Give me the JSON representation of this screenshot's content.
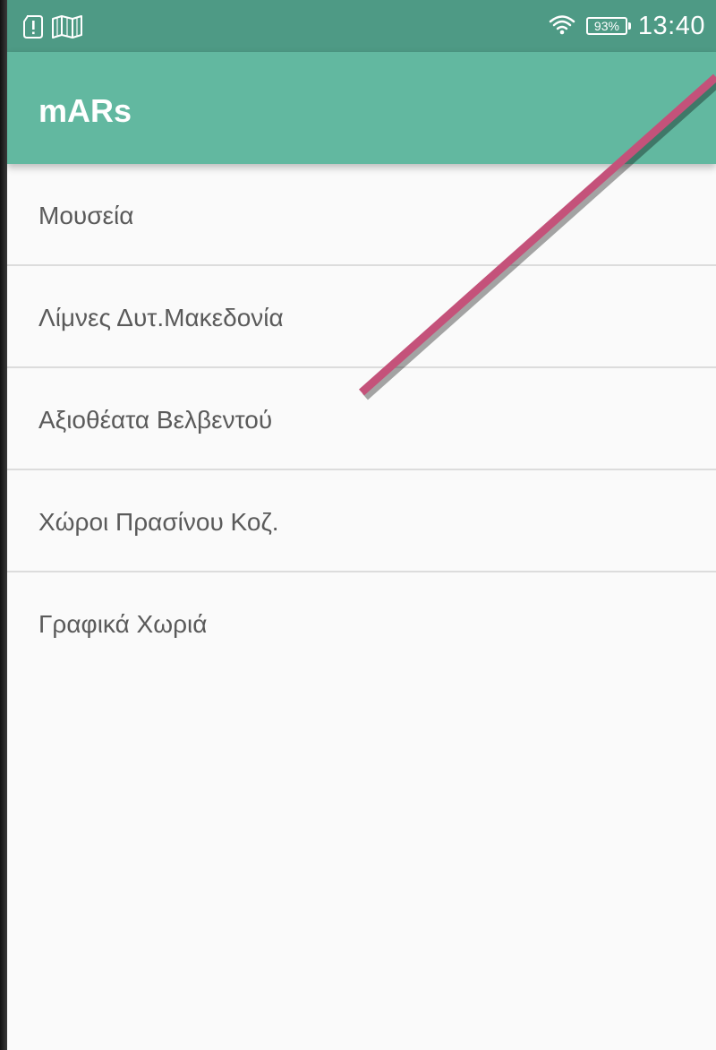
{
  "status_bar": {
    "battery": "93%",
    "time": "13:40"
  },
  "app": {
    "title": "mARs"
  },
  "list": {
    "items": [
      {
        "label": "Μουσεία"
      },
      {
        "label": "Λίμνες Δυτ.Μακεδονία"
      },
      {
        "label": "Αξιοθέατα Βελβεντού"
      },
      {
        "label": "Χώροι Πρασίνου Κοζ."
      },
      {
        "label": "Γραφικά Χωριά"
      }
    ]
  },
  "colors": {
    "status_bar": "#4e9a85",
    "app_bar": "#62b8a0",
    "annotation_line": "#c4527a"
  }
}
